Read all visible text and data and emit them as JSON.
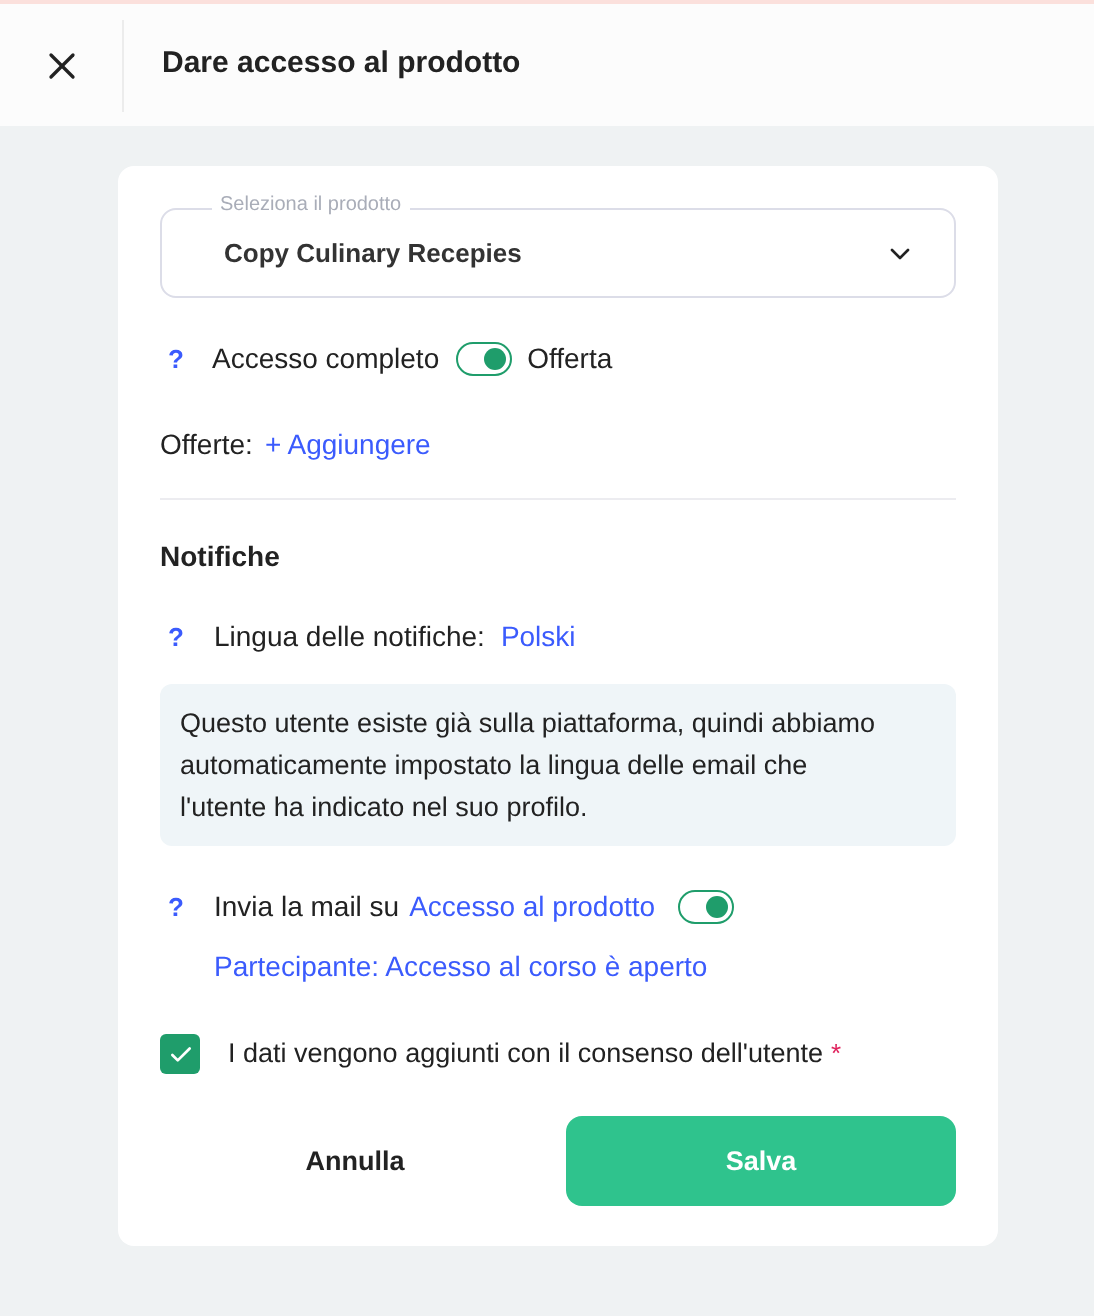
{
  "header": {
    "title": "Dare accesso al prodotto"
  },
  "product_select": {
    "label": "Seleziona il prodotto",
    "value": "Copy Culinary Recepies"
  },
  "access": {
    "help": "?",
    "label_left": "Accesso completo",
    "on": true,
    "label_right": "Offerta"
  },
  "offers": {
    "label": "Offerte:",
    "add_link": "+ Aggiungere"
  },
  "notifications": {
    "heading": "Notifiche",
    "language": {
      "help": "?",
      "label": "Lingua delle notifiche:",
      "value": "Polski"
    },
    "info": "Questo utente esiste già sulla piattaforma, quindi abbiamo automaticamente impostato la lingua delle email che l'utente ha indicato nel suo profilo.",
    "email": {
      "help": "?",
      "prefix": "Invia la mail su",
      "link": "Accesso al prodotto",
      "on": true,
      "event": "Partecipante: Accesso al corso è aperto"
    }
  },
  "consent": {
    "checked": true,
    "text": "I dati vengono aggiunti con il consenso dell'utente",
    "required": "*"
  },
  "buttons": {
    "cancel": "Annulla",
    "save": "Salva"
  }
}
